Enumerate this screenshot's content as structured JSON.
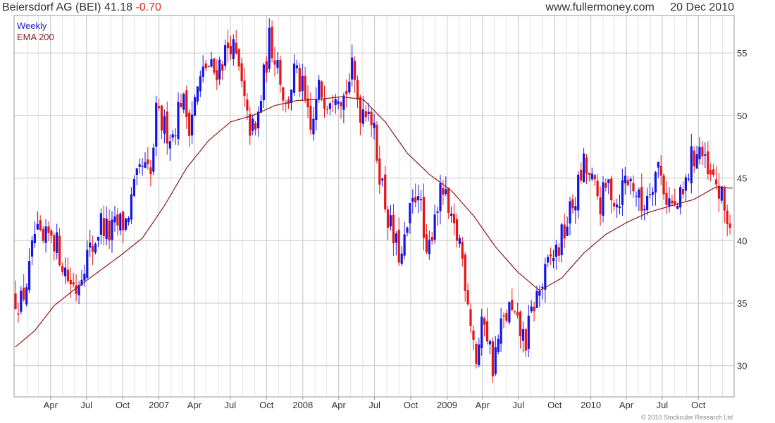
{
  "header": {
    "title": "Beiersdorf AG (BEI)",
    "last": "41.18",
    "change": "-0.70",
    "source": "www.fullermoney.com",
    "date": "20 Dec 2010"
  },
  "copyright": "© 2010 Stockcube Research Ltd",
  "chart_data": {
    "type": "candlestick",
    "frequency": "Weekly",
    "legend": [
      {
        "label": "Weekly",
        "color": "#1f1fbf"
      },
      {
        "label": "EMA 200",
        "color": "#8b1a1a"
      }
    ],
    "colors": {
      "up": "#1414e6",
      "down": "#e81414",
      "ema": "#8b1a1a",
      "grid": "#c8c8c8"
    },
    "ylim": [
      27.5,
      58
    ],
    "y_ticks": [
      30,
      35,
      40,
      45,
      50,
      55
    ],
    "y_axis_side": "right",
    "grid": true,
    "x_start": "2006-01-02",
    "x_end": "2010-12-27",
    "x_ticks": [
      {
        "date": "2006-04-01",
        "label": "Apr"
      },
      {
        "date": "2006-07-01",
        "label": "Jul"
      },
      {
        "date": "2006-10-01",
        "label": "Oct"
      },
      {
        "date": "2007-01-01",
        "label": "2007"
      },
      {
        "date": "2007-04-01",
        "label": "Apr"
      },
      {
        "date": "2007-07-01",
        "label": "Jul"
      },
      {
        "date": "2007-10-01",
        "label": "Oct"
      },
      {
        "date": "2008-01-01",
        "label": "2008"
      },
      {
        "date": "2008-04-01",
        "label": "Apr"
      },
      {
        "date": "2008-07-01",
        "label": "Jul"
      },
      {
        "date": "2008-10-01",
        "label": "Oct"
      },
      {
        "date": "2009-01-01",
        "label": "2009"
      },
      {
        "date": "2009-04-01",
        "label": "Apr"
      },
      {
        "date": "2009-07-01",
        "label": "Jul"
      },
      {
        "date": "2009-10-01",
        "label": "Oct"
      },
      {
        "date": "2010-01-01",
        "label": "2010"
      },
      {
        "date": "2010-04-01",
        "label": "Apr"
      },
      {
        "date": "2010-07-01",
        "label": "Jul"
      },
      {
        "date": "2010-10-01",
        "label": "Oct"
      }
    ],
    "price_path": [
      [
        "2006-01-02",
        35.5
      ],
      [
        "2006-01-16",
        35.0
      ],
      [
        "2006-02-06",
        37.5
      ],
      [
        "2006-02-20",
        40.5
      ],
      [
        "2006-03-13",
        39.5
      ],
      [
        "2006-04-03",
        40.8
      ],
      [
        "2006-04-24",
        39.0
      ],
      [
        "2006-05-15",
        37.0
      ],
      [
        "2006-06-05",
        36.2
      ],
      [
        "2006-06-26",
        38.5
      ],
      [
        "2006-07-17",
        39.5
      ],
      [
        "2006-08-07",
        41.5
      ],
      [
        "2006-08-28",
        40.5
      ],
      [
        "2006-09-18",
        41.2
      ],
      [
        "2006-10-09",
        41.5
      ],
      [
        "2006-10-30",
        44.0
      ],
      [
        "2006-11-20",
        45.8
      ],
      [
        "2006-12-11",
        45.0
      ],
      [
        "2006-12-25",
        50.0
      ],
      [
        "2007-01-15",
        49.0
      ],
      [
        "2007-02-05",
        48.5
      ],
      [
        "2007-02-26",
        51.5
      ],
      [
        "2007-03-19",
        49.5
      ],
      [
        "2007-04-09",
        52.0
      ],
      [
        "2007-04-30",
        54.0
      ],
      [
        "2007-05-21",
        53.5
      ],
      [
        "2007-06-11",
        54.5
      ],
      [
        "2007-07-02",
        56.0
      ],
      [
        "2007-07-23",
        53.5
      ],
      [
        "2007-08-13",
        49.5
      ],
      [
        "2007-09-03",
        48.5
      ],
      [
        "2007-09-24",
        53.0
      ],
      [
        "2007-10-08",
        56.0
      ],
      [
        "2007-10-29",
        54.5
      ],
      [
        "2007-11-19",
        50.5
      ],
      [
        "2007-12-10",
        53.5
      ],
      [
        "2007-12-31",
        52.0
      ],
      [
        "2008-01-21",
        48.5
      ],
      [
        "2008-02-11",
        52.0
      ],
      [
        "2008-03-03",
        51.5
      ],
      [
        "2008-03-24",
        52.5
      ],
      [
        "2008-04-14",
        51.5
      ],
      [
        "2008-05-05",
        53.5
      ],
      [
        "2008-05-26",
        50.5
      ],
      [
        "2008-06-16",
        51.0
      ],
      [
        "2008-07-07",
        47.0
      ],
      [
        "2008-07-28",
        43.0
      ],
      [
        "2008-08-18",
        40.0
      ],
      [
        "2008-09-08",
        38.5
      ],
      [
        "2008-09-29",
        42.0
      ],
      [
        "2008-10-20",
        44.5
      ],
      [
        "2008-11-10",
        38.0
      ],
      [
        "2008-12-01",
        42.5
      ],
      [
        "2008-12-22",
        44.0
      ],
      [
        "2009-01-12",
        41.0
      ],
      [
        "2009-02-02",
        40.0
      ],
      [
        "2009-02-23",
        35.5
      ],
      [
        "2009-03-16",
        30.5
      ],
      [
        "2009-04-06",
        34.0
      ],
      [
        "2009-04-27",
        30.0
      ],
      [
        "2009-05-18",
        33.0
      ],
      [
        "2009-06-08",
        34.5
      ],
      [
        "2009-06-29",
        33.0
      ],
      [
        "2009-07-20",
        32.0
      ],
      [
        "2009-08-10",
        35.0
      ],
      [
        "2009-08-31",
        36.5
      ],
      [
        "2009-09-21",
        38.5
      ],
      [
        "2009-10-12",
        39.5
      ],
      [
        "2009-11-02",
        41.5
      ],
      [
        "2009-11-23",
        43.5
      ],
      [
        "2009-12-14",
        46.0
      ],
      [
        "2010-01-04",
        44.5
      ],
      [
        "2010-01-25",
        43.0
      ],
      [
        "2010-02-15",
        44.5
      ],
      [
        "2010-03-08",
        43.0
      ],
      [
        "2010-03-29",
        45.0
      ],
      [
        "2010-04-19",
        44.5
      ],
      [
        "2010-05-10",
        42.5
      ],
      [
        "2010-05-31",
        44.5
      ],
      [
        "2010-06-21",
        46.0
      ],
      [
        "2010-07-12",
        43.5
      ],
      [
        "2010-08-02",
        42.5
      ],
      [
        "2010-08-23",
        43.5
      ],
      [
        "2010-09-13",
        46.5
      ],
      [
        "2010-10-04",
        47.5
      ],
      [
        "2010-10-25",
        45.0
      ],
      [
        "2010-11-15",
        44.5
      ],
      [
        "2010-12-06",
        42.5
      ],
      [
        "2010-12-20",
        41.2
      ]
    ],
    "ema_path": [
      [
        "2006-01-02",
        31.5
      ],
      [
        "2006-02-20",
        32.8
      ],
      [
        "2006-04-10",
        34.8
      ],
      [
        "2006-06-05",
        36.2
      ],
      [
        "2006-07-31",
        37.5
      ],
      [
        "2006-09-25",
        38.8
      ],
      [
        "2006-11-20",
        40.2
      ],
      [
        "2007-01-15",
        42.8
      ],
      [
        "2007-03-12",
        45.8
      ],
      [
        "2007-05-07",
        48.0
      ],
      [
        "2007-07-02",
        49.5
      ],
      [
        "2007-08-27",
        50.0
      ],
      [
        "2007-10-22",
        50.8
      ],
      [
        "2007-12-17",
        51.2
      ],
      [
        "2008-02-11",
        51.3
      ],
      [
        "2008-04-07",
        51.5
      ],
      [
        "2008-06-02",
        51.3
      ],
      [
        "2008-07-28",
        49.5
      ],
      [
        "2008-09-22",
        47.0
      ],
      [
        "2008-11-17",
        45.3
      ],
      [
        "2009-01-12",
        44.0
      ],
      [
        "2009-03-09",
        42.0
      ],
      [
        "2009-05-04",
        39.5
      ],
      [
        "2009-06-29",
        37.5
      ],
      [
        "2009-08-24",
        36.0
      ],
      [
        "2009-10-19",
        37.0
      ],
      [
        "2009-12-14",
        39.0
      ],
      [
        "2010-02-08",
        40.5
      ],
      [
        "2010-04-05",
        41.5
      ],
      [
        "2010-05-31",
        42.3
      ],
      [
        "2010-07-26",
        42.8
      ],
      [
        "2010-09-20",
        43.3
      ],
      [
        "2010-11-15",
        44.3
      ],
      [
        "2010-12-20",
        44.2
      ]
    ]
  }
}
